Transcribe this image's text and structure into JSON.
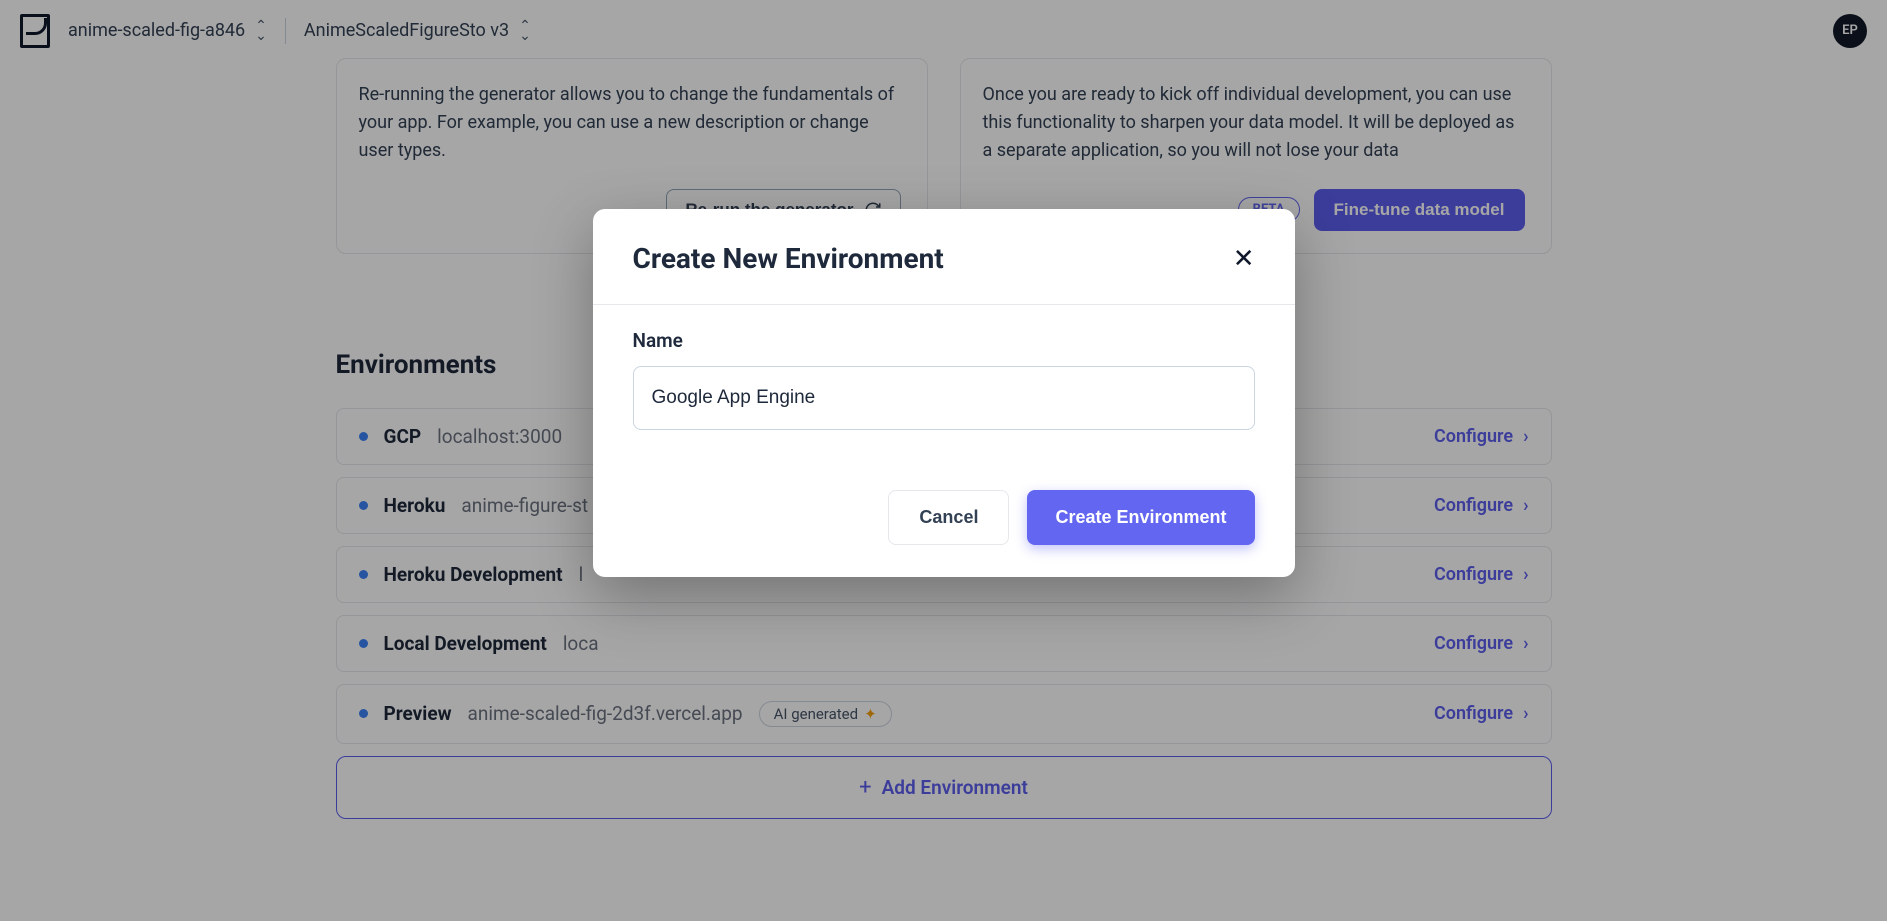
{
  "header": {
    "breadcrumb1": "anime-scaled-fig-a846",
    "breadcrumb2": "AnimeScaledFigureSto v3",
    "avatar": "EP"
  },
  "cards": {
    "left_text": "Re-running the generator allows you to change the fundamentals of your app. For example, you can use a new description or change user types.",
    "left_button": "Re-run the generator",
    "right_text": "Once you are ready to kick off individual development, you can use this functionality to sharpen your data model. It will be deployed as a separate application, so you will not lose your data",
    "beta": "BETA",
    "right_button": "Fine-tune data model"
  },
  "section_title": "Environments",
  "environments": [
    {
      "name": "GCP",
      "url": "localhost:3000",
      "ai": false
    },
    {
      "name": "Heroku",
      "url": "anime-figure-st",
      "ai": false
    },
    {
      "name": "Heroku Development",
      "url": "l",
      "ai": false
    },
    {
      "name": "Local Development",
      "url": "loca",
      "ai": false
    },
    {
      "name": "Preview",
      "url": "anime-scaled-fig-2d3f.vercel.app",
      "ai": true
    }
  ],
  "configure_label": "Configure",
  "ai_label": "AI generated",
  "add_env_label": "Add Environment",
  "modal": {
    "title": "Create New Environment",
    "field_label": "Name",
    "field_value": "Google App Engine",
    "cancel": "Cancel",
    "create": "Create Environment"
  }
}
